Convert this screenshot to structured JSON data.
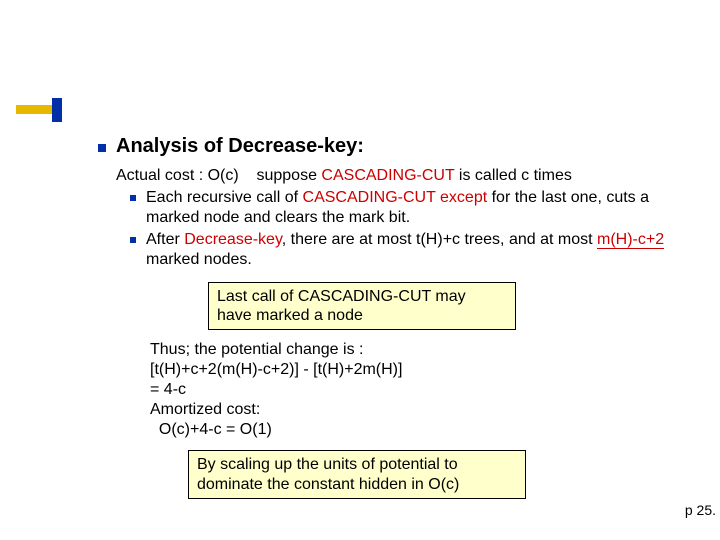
{
  "heading": "Analysis of Decrease-key:",
  "cost_plain": "Actual cost : O(c)    suppose ",
  "cost_red": "CASCADING-CUT",
  "cost_tail": " is called c times",
  "sub1_a": "Each recursive call of ",
  "sub1_red1": "CASCADING-CUT",
  "sub1_b": " ",
  "sub1_red2": "except",
  "sub1_c": " for the last one, cuts a marked node and clears the mark bit.",
  "sub2_a": "After ",
  "sub2_red1": "Decrease-key",
  "sub2_b": ", there are at most ",
  "sub2_c": "t(H)+c",
  "sub2_d": " trees, and at most ",
  "sub2_e": "m(H)-c+2",
  "sub2_f": " marked nodes.",
  "callout1_l1": "Last call of CASCADING-CUT may",
  "callout1_l2": "have marked a node",
  "thus1": "Thus; the potential change is :",
  "thus2": "[t(H)+c+2(m(H)-c+2)] - [t(H)+2m(H)]",
  "thus3": "= 4-c",
  "thus4": "Amortized cost:",
  "thus5": "  O(c)+4-c = O(1)",
  "callout2_l1": "By scaling up the units of potential to",
  "callout2_l2": "dominate the constant hidden in O(c)",
  "page": "p 25."
}
